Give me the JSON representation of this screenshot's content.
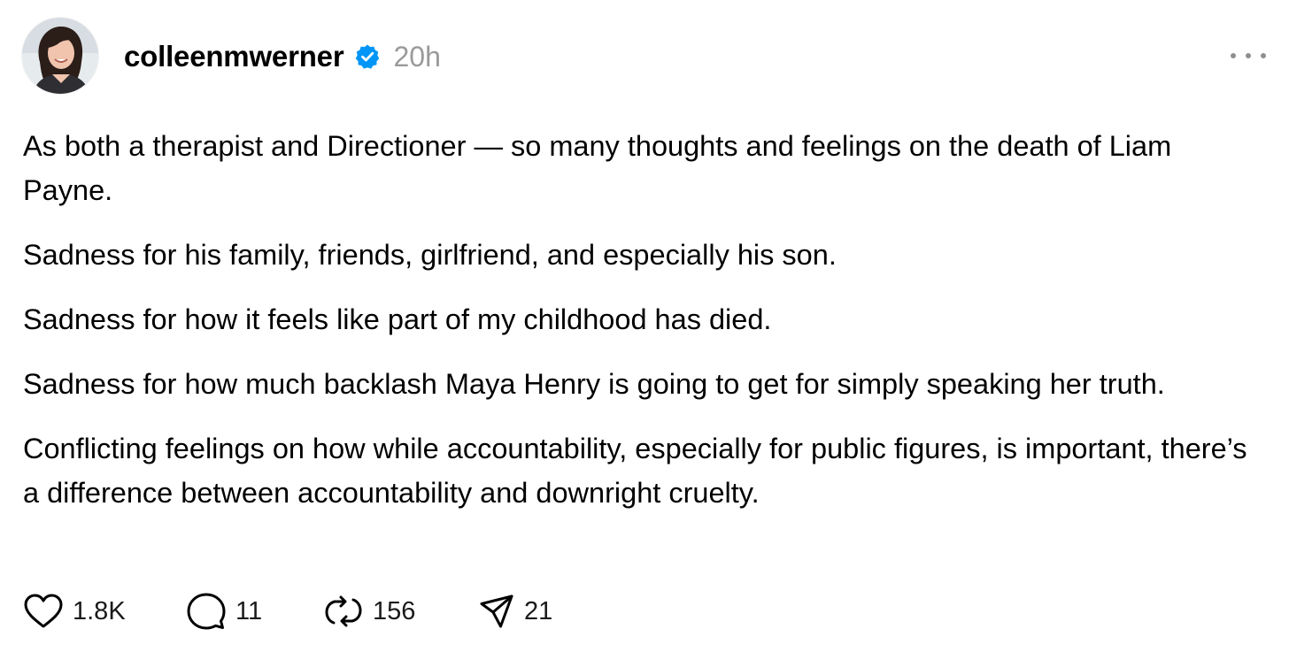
{
  "post": {
    "author": {
      "username": "colleenmwerner",
      "verified": true,
      "avatar": "profile-photo"
    },
    "timestamp": "20h",
    "more_icon": "ellipsis-icon",
    "paragraphs": [
      "As both a therapist and Directioner — so many thoughts and feelings on the death of Liam Payne.",
      "Sadness for his family, friends, girlfriend, and especially his son.",
      "Sadness for how it feels like part of my childhood has died.",
      "Sadness for how much backlash Maya Henry is going to get for simply speaking her truth.",
      "Conflicting feelings on how while accountability, especially for public figures, is important, there’s a difference between accountability and downright cruelty."
    ],
    "actions": {
      "likes": "1.8K",
      "replies": "11",
      "reposts": "156",
      "shares": "21"
    },
    "icons": {
      "like": "heart-icon",
      "reply": "comment-bubble-icon",
      "repost": "repost-arrows-icon",
      "share": "paper-plane-icon",
      "verified": "verified-badge-icon"
    },
    "colors": {
      "verified_badge": "#0095f6",
      "timestamp": "#9a9a9a",
      "text": "#000000"
    }
  }
}
